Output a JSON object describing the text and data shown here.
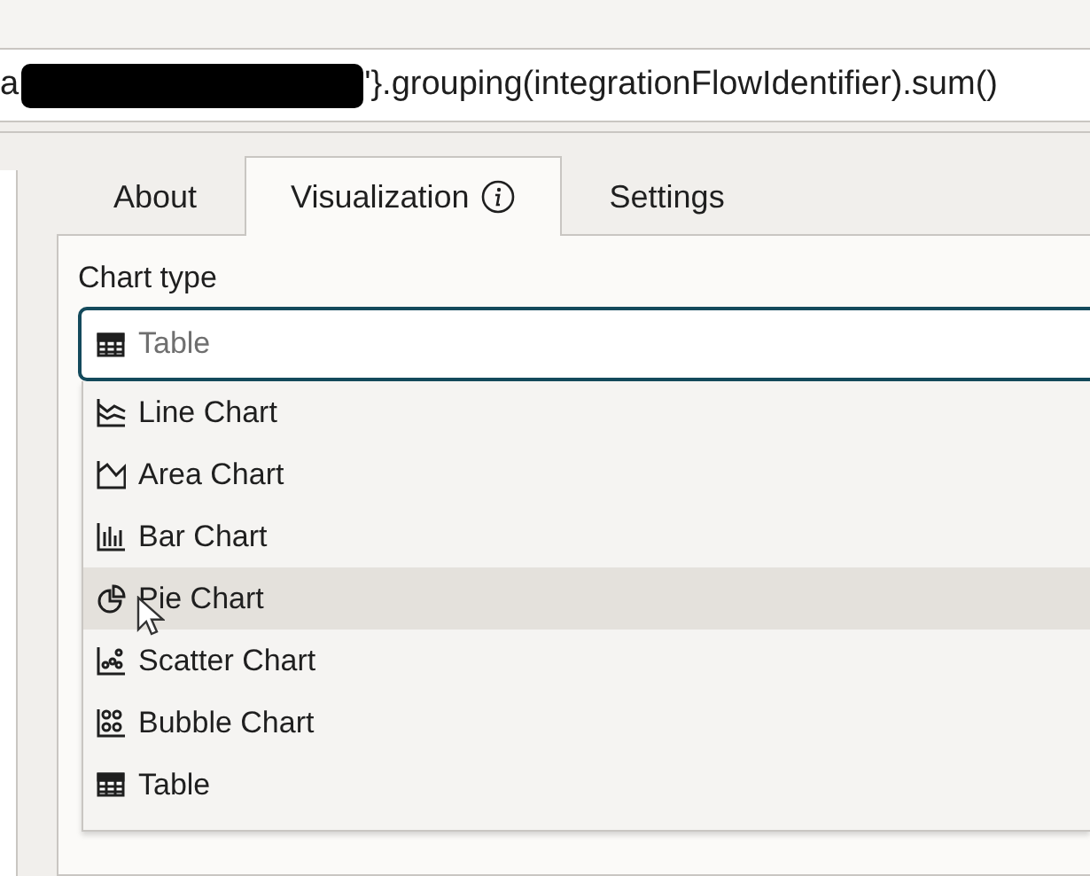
{
  "query": {
    "prefix": "a",
    "suffix": "'}.grouping(integrationFlowIdentifier).sum()",
    "redacted": true
  },
  "tabs": [
    {
      "label": "About",
      "selected": false,
      "info": false
    },
    {
      "label": "Visualization",
      "selected": true,
      "info": true
    },
    {
      "label": "Settings",
      "selected": false,
      "info": false
    }
  ],
  "chart_type": {
    "label": "Chart type",
    "placeholder": "Table",
    "kind": "table"
  },
  "options": [
    {
      "label": "Line Chart",
      "kind": "line",
      "selected": false
    },
    {
      "label": "Area Chart",
      "kind": "area",
      "selected": false
    },
    {
      "label": "Bar Chart",
      "kind": "bar",
      "selected": false
    },
    {
      "label": "Pie Chart",
      "kind": "pie",
      "selected": true
    },
    {
      "label": "Scatter Chart",
      "kind": "scatter",
      "selected": false
    },
    {
      "label": "Bubble Chart",
      "kind": "bubble",
      "selected": false
    },
    {
      "label": "Table",
      "kind": "table",
      "selected": false
    }
  ]
}
